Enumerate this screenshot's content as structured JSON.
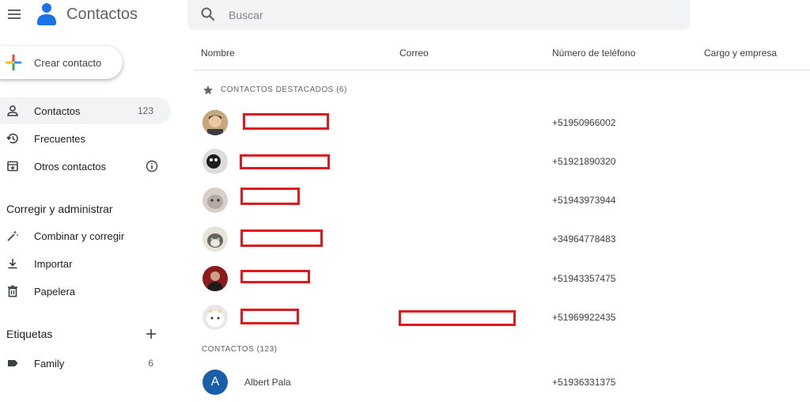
{
  "app": {
    "title": "Contactos"
  },
  "search": {
    "placeholder": "Buscar"
  },
  "sidebar": {
    "create_label": "Crear contacto",
    "items": [
      {
        "label": "Contactos",
        "count": "123",
        "icon": "person-icon"
      },
      {
        "label": "Frecuentes",
        "icon": "history-icon"
      },
      {
        "label": "Otros contactos",
        "icon": "archive-icon"
      }
    ],
    "manage_title": "Corregir y administrar",
    "manage_items": [
      {
        "label": "Combinar y corregir",
        "icon": "magic-wand-icon"
      },
      {
        "label": "Importar",
        "icon": "download-icon"
      },
      {
        "label": "Papelera",
        "icon": "trash-icon"
      }
    ],
    "labels_title": "Etiquetas",
    "labels": [
      {
        "label": "Family",
        "count": "6",
        "icon": "label-icon"
      }
    ]
  },
  "table": {
    "columns": [
      "Nombre",
      "Correo",
      "Número de teléfono",
      "Cargo y empresa"
    ],
    "starred_group": "CONTACTOS DESTACADOS (6)",
    "starred": [
      {
        "phone": "+51950966002"
      },
      {
        "phone": "+51921890320"
      },
      {
        "phone": "+51943973944"
      },
      {
        "phone": "+34964778483"
      },
      {
        "phone": "+51943357475"
      },
      {
        "phone": "+51969922435"
      }
    ],
    "contacts_group": "CONTACTOS (123)",
    "contacts": [
      {
        "initial": "A",
        "name": "Albert Pala",
        "phone": "+51936331375"
      }
    ]
  },
  "colors": {
    "accent": "#1a73e8",
    "redaction": "#e0191e",
    "avatar_letter_bg": "#1a5da8"
  }
}
